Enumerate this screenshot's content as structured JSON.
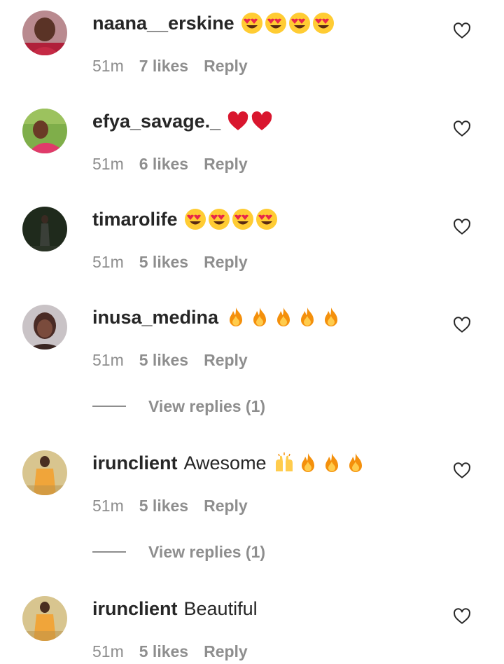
{
  "colors": {
    "text_primary": "#262626",
    "text_secondary": "#8e8e8e",
    "background": "#ffffff"
  },
  "comments": [
    {
      "username": "naana__erskine",
      "text": "",
      "emojis": [
        "heart-eyes-emoji",
        "heart-eyes-emoji",
        "heart-eyes-emoji",
        "heart-eyes-emoji"
      ],
      "time": "51m",
      "likes": "7 likes",
      "reply": "Reply"
    },
    {
      "username": "efya_savage._",
      "text": "",
      "emojis": [
        "red-heart-emoji",
        "red-heart-emoji"
      ],
      "time": "51m",
      "likes": "6 likes",
      "reply": "Reply"
    },
    {
      "username": "timarolife",
      "text": "",
      "emojis": [
        "heart-eyes-emoji",
        "heart-eyes-emoji",
        "heart-eyes-emoji",
        "heart-eyes-emoji"
      ],
      "time": "51m",
      "likes": "5 likes",
      "reply": "Reply"
    },
    {
      "username": "inusa_medina",
      "text": "",
      "emojis": [
        "fire-emoji",
        "fire-emoji",
        "fire-emoji",
        "fire-emoji",
        "fire-emoji"
      ],
      "time": "51m",
      "likes": "5 likes",
      "reply": "Reply",
      "view_replies": "View replies (1)"
    },
    {
      "username": "irunclient",
      "text": "Awesome",
      "emojis": [
        "raising-hands-emoji",
        "fire-emoji",
        "fire-emoji",
        "fire-emoji"
      ],
      "time": "51m",
      "likes": "5 likes",
      "reply": "Reply",
      "view_replies": "View replies (1)"
    },
    {
      "username": "irunclient",
      "text": "Beautiful",
      "emojis": [],
      "time": "51m",
      "likes": "5 likes",
      "reply": "Reply"
    }
  ]
}
